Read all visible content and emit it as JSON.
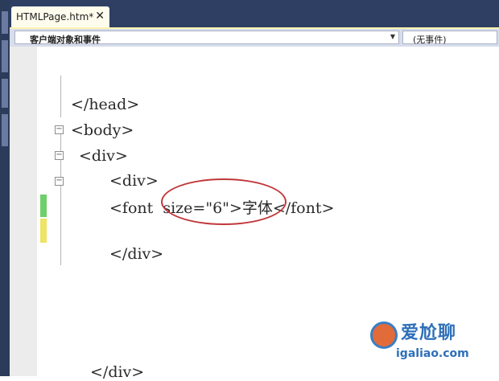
{
  "tab": {
    "title": "HTMLPage.htm*",
    "close_glyph": "✕"
  },
  "navbar": {
    "left_value": "客户端对象和事件",
    "right_value": "(无事件)"
  },
  "code_lines": [
    "</head>",
    "<body>",
    "<div>",
    "<div>",
    "<font  size=\"6\">字体</font>",
    "</div>",
    "</div>"
  ],
  "watermark": {
    "site": "爱尬聊",
    "url": "igaliao.com"
  },
  "colors": {
    "tab_bar": "#2e3f63",
    "change_saved": "#6fcf6a",
    "change_unsaved": "#eee466",
    "annotation": "#c0373a"
  }
}
